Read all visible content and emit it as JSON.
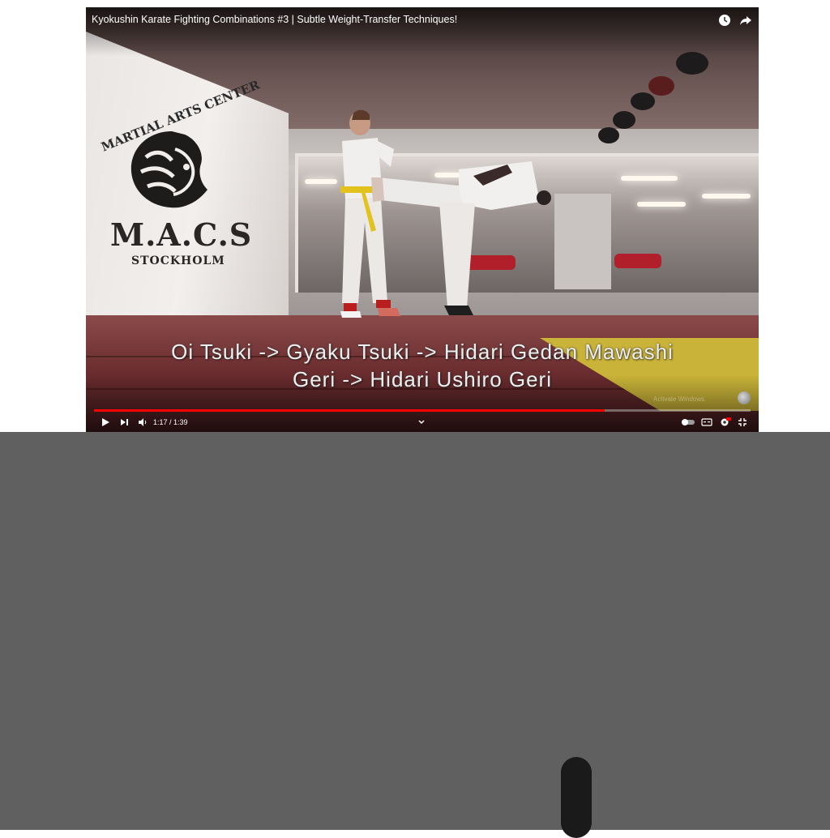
{
  "player": {
    "title": "Kyokushin Karate Fighting Combinations #3 | Subtle Weight-Transfer Techniques!",
    "subtitle_line1": "Oi Tsuki -> Gyaku Tsuki -> Hidari Gedan Mawashi",
    "subtitle_line2": "Geri -> Hidari Ushiro Geri",
    "time_display": "1:17 / 1:39",
    "progress_fraction": 0.7778,
    "watermark": "Activate Windows",
    "accent_color": "#ff0000",
    "icons": {
      "watch_later": "clock-icon",
      "share": "share-icon",
      "play": "play-icon",
      "next": "next-icon",
      "volume": "volume-icon",
      "chapters": "chevron-down-icon",
      "autoplay": "autoplay-toggle-icon",
      "captions": "captions-icon",
      "settings": "settings-icon",
      "exit_fullscreen": "exit-fullscreen-icon"
    }
  },
  "scene": {
    "wall_text_arc": "MARTIAL ARTS CENTER",
    "wall_logo_main": "M.A.C.S",
    "wall_logo_sub": "STOCKHOLM"
  }
}
